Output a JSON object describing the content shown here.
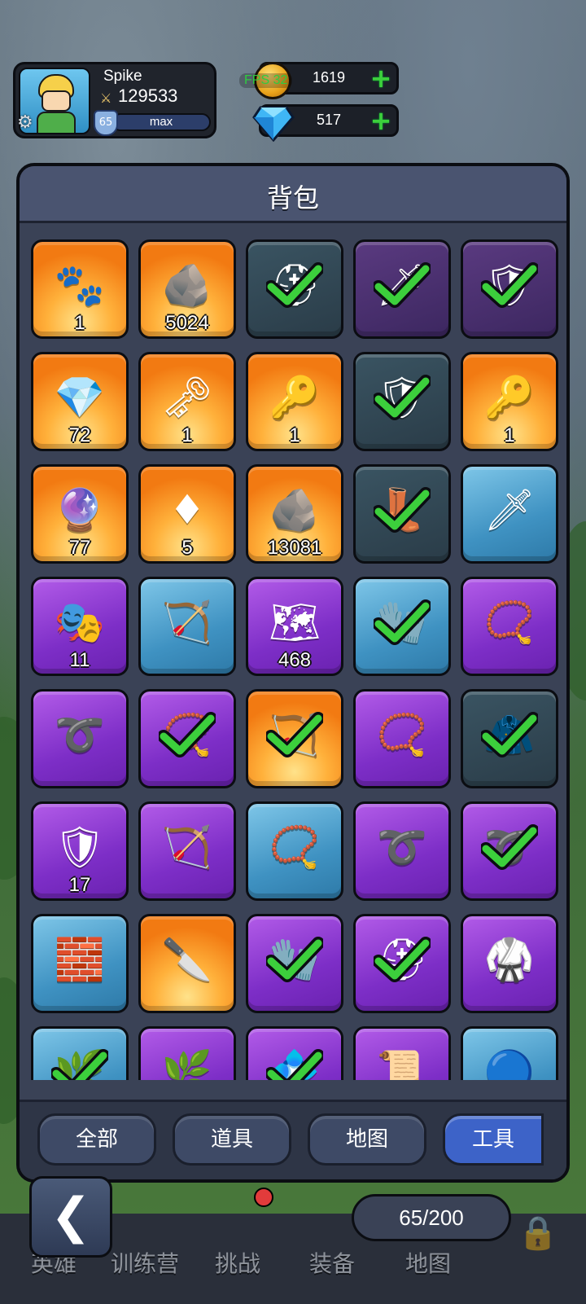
{
  "player": {
    "name": "Spike",
    "power": "129533",
    "level": "65",
    "level_bar_text": "max"
  },
  "currencies": {
    "gold": "1619",
    "gems": "517",
    "fps_overlay": "FPS 32"
  },
  "panel": {
    "title": "背包"
  },
  "items": [
    {
      "rarity": "orange",
      "icon": "paw-icon",
      "glyph": "🐾",
      "count": "1",
      "equipped": false
    },
    {
      "rarity": "orange",
      "icon": "rune-stone-icon",
      "glyph": "🪨",
      "count": "5024",
      "equipped": false
    },
    {
      "rarity": "dark",
      "icon": "helmet-icon",
      "glyph": "⛑",
      "count": "",
      "equipped": true
    },
    {
      "rarity": "darkpurple",
      "icon": "dagger-icon",
      "glyph": "🗡",
      "count": "",
      "equipped": true
    },
    {
      "rarity": "darkpurple",
      "icon": "armor-icon",
      "glyph": "🛡",
      "count": "",
      "equipped": true
    },
    {
      "rarity": "orange",
      "icon": "crystal-ore-icon",
      "glyph": "💎",
      "count": "72",
      "equipped": false
    },
    {
      "rarity": "orange",
      "icon": "silver-key-icon",
      "glyph": "🗝",
      "count": "1",
      "equipped": false
    },
    {
      "rarity": "orange",
      "icon": "gold-key-icon",
      "glyph": "🔑",
      "count": "1",
      "equipped": false
    },
    {
      "rarity": "dark",
      "icon": "shield-icon",
      "glyph": "🛡",
      "count": "",
      "equipped": true
    },
    {
      "rarity": "orange",
      "icon": "bronze-key-icon",
      "glyph": "🔑",
      "count": "1",
      "equipped": false
    },
    {
      "rarity": "orange",
      "icon": "purple-dust-icon",
      "glyph": "🔮",
      "count": "77",
      "equipped": false
    },
    {
      "rarity": "orange",
      "icon": "red-crystal-icon",
      "glyph": "♦",
      "count": "5",
      "equipped": false
    },
    {
      "rarity": "orange",
      "icon": "blue-stone-icon",
      "glyph": "🪨",
      "count": "13081",
      "equipped": false
    },
    {
      "rarity": "dark",
      "icon": "boots-icon",
      "glyph": "👢",
      "count": "",
      "equipped": true
    },
    {
      "rarity": "blue",
      "icon": "sword-icon",
      "glyph": "🗡",
      "count": "",
      "equipped": false
    },
    {
      "rarity": "purple",
      "icon": "tiki-mask-icon",
      "glyph": "🎭",
      "count": "11",
      "equipped": false
    },
    {
      "rarity": "blue",
      "icon": "arrows-icon",
      "glyph": "🏹",
      "count": "",
      "equipped": false
    },
    {
      "rarity": "purple",
      "icon": "treasure-map-icon",
      "glyph": "🗺",
      "count": "468",
      "equipped": false
    },
    {
      "rarity": "blue",
      "icon": "gauntlet-icon",
      "glyph": "🧤",
      "count": "",
      "equipped": true
    },
    {
      "rarity": "purple",
      "icon": "necklace-icon",
      "glyph": "📿",
      "count": "",
      "equipped": false
    },
    {
      "rarity": "purple",
      "icon": "rope-icon",
      "glyph": "➰",
      "count": "",
      "equipped": false
    },
    {
      "rarity": "purple",
      "icon": "necklace-icon",
      "glyph": "📿",
      "count": "",
      "equipped": true
    },
    {
      "rarity": "orange",
      "icon": "arrows-icon",
      "glyph": "🏹",
      "count": "",
      "equipped": true
    },
    {
      "rarity": "purple",
      "icon": "necklace-icon",
      "glyph": "📿",
      "count": "",
      "equipped": false
    },
    {
      "rarity": "dark",
      "icon": "cloak-icon",
      "glyph": "🧥",
      "count": "",
      "equipped": true
    },
    {
      "rarity": "purple",
      "icon": "green-shield-icon",
      "glyph": "🛡",
      "count": "17",
      "equipped": false
    },
    {
      "rarity": "purple",
      "icon": "arrows-icon",
      "glyph": "🏹",
      "count": "",
      "equipped": false
    },
    {
      "rarity": "blue",
      "icon": "necklace-icon",
      "glyph": "📿",
      "count": "",
      "equipped": false
    },
    {
      "rarity": "purple",
      "icon": "rope-icon",
      "glyph": "➰",
      "count": "",
      "equipped": false
    },
    {
      "rarity": "purple",
      "icon": "rope-icon",
      "glyph": "➰",
      "count": "",
      "equipped": true
    },
    {
      "rarity": "blue",
      "icon": "bracer-icon",
      "glyph": "🧱",
      "count": "",
      "equipped": false
    },
    {
      "rarity": "orange",
      "icon": "curved-blade-icon",
      "glyph": "🔪",
      "count": "",
      "equipped": false
    },
    {
      "rarity": "purple",
      "icon": "gauntlet-icon",
      "glyph": "🧤",
      "count": "",
      "equipped": true
    },
    {
      "rarity": "purple",
      "icon": "helmet-icon",
      "glyph": "⛑",
      "count": "",
      "equipped": true
    },
    {
      "rarity": "purple",
      "icon": "chest-armor-icon",
      "glyph": "🥋",
      "count": "",
      "equipped": false
    },
    {
      "rarity": "blue",
      "icon": "leaf-icon",
      "glyph": "🌿",
      "count": "",
      "equipped": true
    },
    {
      "rarity": "purple",
      "icon": "leaf-icon",
      "glyph": "🌿",
      "count": "",
      "equipped": false
    },
    {
      "rarity": "purple",
      "icon": "crystal-icon",
      "glyph": "💠",
      "count": "",
      "equipped": true
    },
    {
      "rarity": "purple",
      "icon": "scroll-icon",
      "glyph": "📜",
      "count": "",
      "equipped": false
    },
    {
      "rarity": "blue",
      "icon": "orb-icon",
      "glyph": "🔵",
      "count": "",
      "equipped": false
    }
  ],
  "tabs": [
    {
      "label": "全部",
      "active": false
    },
    {
      "label": "道具",
      "active": false
    },
    {
      "label": "地图",
      "active": false
    },
    {
      "label": "工具",
      "active": true
    }
  ],
  "bottom_nav": {
    "items": [
      "英雄",
      "训练营",
      "挑战",
      "装备",
      "地图"
    ],
    "capacity": "65/200",
    "back_glyph": "❮"
  },
  "colors": {
    "check_green": "#3ccf3c",
    "active_tab": "#3d63c8"
  }
}
